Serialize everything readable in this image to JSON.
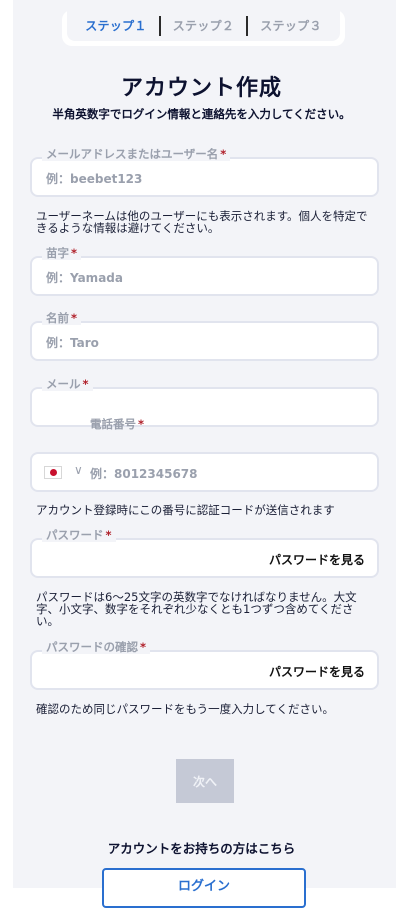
{
  "stepper": {
    "steps": [
      "ステップ１",
      "ステップ２",
      "ステップ３"
    ],
    "active_index": 0
  },
  "header": {
    "title": "アカウント作成",
    "subtitle": "半角英数字でログイン情報と連絡先を入力してください。"
  },
  "form": {
    "username": {
      "label": "メールアドレスまたはユーザー名",
      "placeholder": "例：beebet123",
      "help": "ユーザーネームは他のユーザーにも表示されます。個人を特定できるような情報は避けてください。"
    },
    "last_name": {
      "label": "苗字",
      "placeholder": "例：Yamada"
    },
    "first_name": {
      "label": "名前",
      "placeholder": "例：Taro"
    },
    "email": {
      "label": "メール",
      "placeholder": ""
    },
    "phone": {
      "label": "電話番号",
      "placeholder": "例：8012345678",
      "chevron": "∨",
      "help": "アカウント登録時にこの番号に認証コードが送信されます"
    },
    "password": {
      "label": "パスワード",
      "show_label": "パスワードを見る",
      "help": "パスワードは6〜25文字の英数字でなければなりません。大文字、小文字、数字をそれぞれ少なくとも1つずつ含めてください。"
    },
    "password_confirm": {
      "label": "パスワードの確認",
      "show_label": "パスワードを見る",
      "help": "確認のため同じパスワードをもう一度入力してください。"
    },
    "required_mark": "*"
  },
  "actions": {
    "next_label": "次へ",
    "have_account": "アカウントをお持ちの方はこちら",
    "login_label": "ログイン"
  },
  "colors": {
    "accent": "#2a6fcf",
    "required": "#b0202a",
    "muted": "#9aa0ad"
  }
}
